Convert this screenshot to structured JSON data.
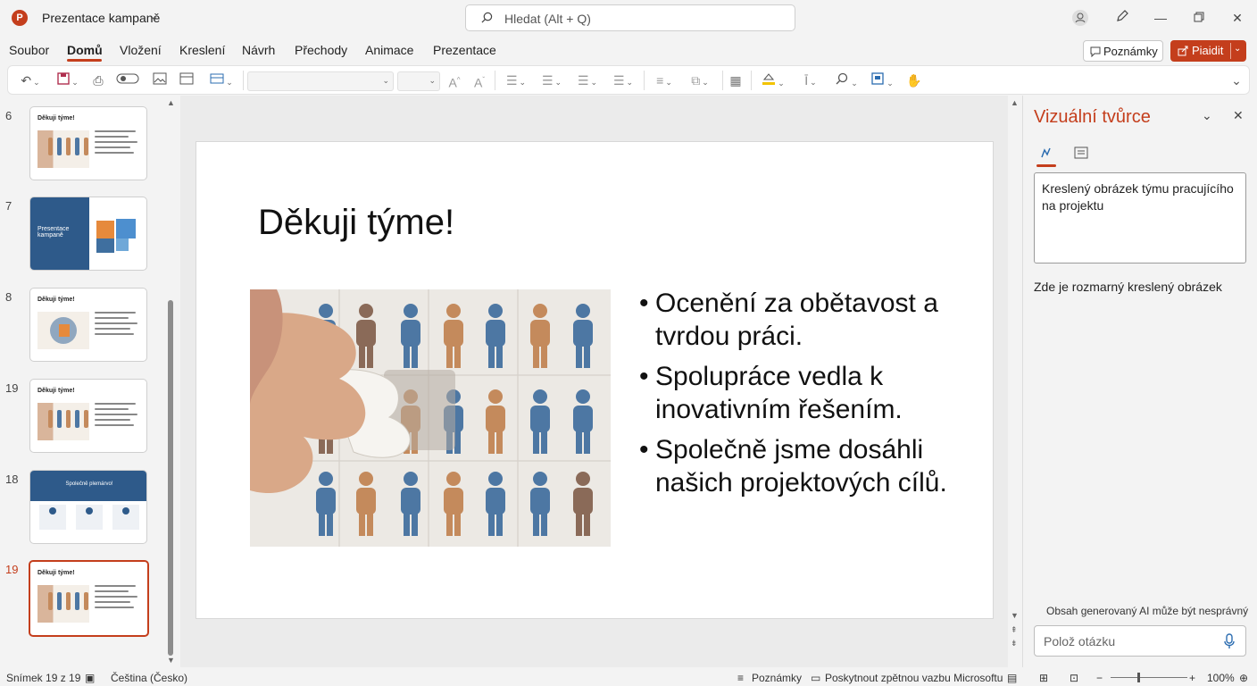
{
  "titlebar": {
    "app_logo": "P",
    "doc_title": "Prezentace kampaně",
    "search_placeholder": "Hledat (Alt + Q)"
  },
  "menu": {
    "items": [
      "Soubor",
      "Domů",
      "Vložení",
      "Kreslení",
      "Návrh",
      "Přechody",
      "Animace",
      "Prezentace"
    ],
    "active_index": 1,
    "notes_label": "Poznámky",
    "share_label": "Piaidit"
  },
  "thumbnails": [
    {
      "num": "6",
      "title": "Děkuji týme!",
      "kind": "image",
      "selected": false
    },
    {
      "num": "7",
      "title": "Presentace kampaně",
      "kind": "title",
      "selected": false
    },
    {
      "num": "8",
      "title": "Děkuji týme!",
      "kind": "image2",
      "selected": false
    },
    {
      "num": "19",
      "title": "Děkuji týme!",
      "kind": "image",
      "selected": false
    },
    {
      "num": "18",
      "title": "Společně plemárvo!",
      "kind": "cards",
      "selected": false
    },
    {
      "num": "19",
      "title": "Děkuji týme!",
      "kind": "image",
      "selected": true
    }
  ],
  "slide": {
    "title": "Děkuji týme!",
    "bullets": [
      "Ocenění za obětavost a tvrdou práci.",
      "Spolupráce vedla k inovativním řešením.",
      "Společně jsme dosáhli našich projektových cílů."
    ]
  },
  "pane": {
    "title": "Vizuální tvůrce",
    "prompt": "Kreslený obrázek týmu pracujícího na projektu",
    "result": "Zde je rozmarný kreslený obrázek",
    "ai_note": "Obsah generovaný AI může být nesprávný",
    "ask_placeholder": "Polož otázku"
  },
  "status": {
    "slide_info": "Snímek 19 z 19",
    "language": "Čeština (Česko)",
    "notes": "Poznámky",
    "feedback": "Poskytnout zpětnou vazbu Microsoftu",
    "zoom": "100%"
  },
  "colors": {
    "accent": "#c43e1c",
    "figure_blue": "#4d77a3",
    "figure_orange": "#c48a5c",
    "figure_brown": "#8a6a58"
  }
}
